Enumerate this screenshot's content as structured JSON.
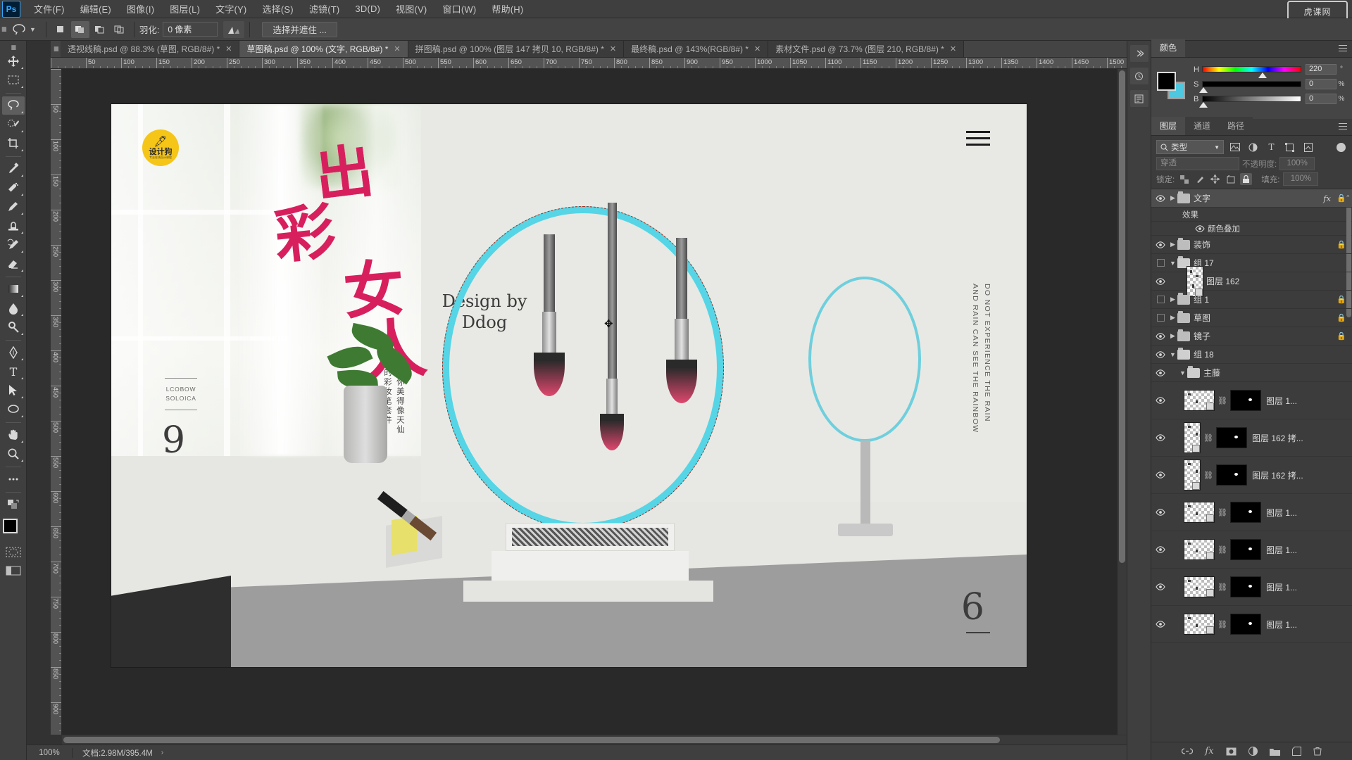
{
  "app": {
    "name": "Ps"
  },
  "menubar": {
    "items": [
      {
        "label": "文件(F)"
      },
      {
        "label": "编辑(E)"
      },
      {
        "label": "图像(I)"
      },
      {
        "label": "图层(L)"
      },
      {
        "label": "文字(Y)"
      },
      {
        "label": "选择(S)"
      },
      {
        "label": "滤镜(T)"
      },
      {
        "label": "3D(D)"
      },
      {
        "label": "视图(V)"
      },
      {
        "label": "窗口(W)"
      },
      {
        "label": "帮助(H)"
      }
    ],
    "watermark": "虎课网"
  },
  "optionsbar": {
    "tool": "lasso-tool",
    "feather_label": "羽化:",
    "feather_value": "0 像素",
    "antialias_name": "anti-alias-icon",
    "select_and_mask": "选择并遮住 ...",
    "selection_modes": [
      "new-selection",
      "add-to-selection",
      "subtract-from-selection",
      "intersect-selection"
    ],
    "active_mode_index": 1
  },
  "tabs": [
    {
      "label": "透视线稿.psd @ 88.3% (草图, RGB/8#) *",
      "active": false
    },
    {
      "label": "草图稿.psd @ 100% (文字, RGB/8#) *",
      "active": true
    },
    {
      "label": "拼图稿.psd @ 100% (图层 147 拷贝 10, RGB/8#) *",
      "active": false
    },
    {
      "label": "最终稿.psd @ 143%(RGB/8#) *",
      "active": false
    },
    {
      "label": "素材文件.psd @ 73.7% (图层 210, RGB/8#) *",
      "active": false
    }
  ],
  "toolbar": {
    "tools": [
      {
        "name": "move-tool",
        "glyph": "move"
      },
      {
        "name": "rectangular-marquee-tool",
        "glyph": "marquee"
      },
      {
        "name": "lasso-tool",
        "glyph": "lasso",
        "active": true
      },
      {
        "name": "quick-selection-tool",
        "glyph": "quickselect"
      },
      {
        "name": "crop-tool",
        "glyph": "crop"
      },
      {
        "name": "eyedropper-tool",
        "glyph": "eyedropper"
      },
      {
        "name": "spot-healing-brush-tool",
        "glyph": "heal"
      },
      {
        "name": "brush-tool",
        "glyph": "brush"
      },
      {
        "name": "clone-stamp-tool",
        "glyph": "stamp"
      },
      {
        "name": "history-brush-tool",
        "glyph": "historybrush"
      },
      {
        "name": "eraser-tool",
        "glyph": "eraser"
      },
      {
        "name": "gradient-tool",
        "glyph": "gradient"
      },
      {
        "name": "blur-tool",
        "glyph": "blur"
      },
      {
        "name": "dodge-tool",
        "glyph": "dodge"
      },
      {
        "name": "pen-tool",
        "glyph": "pen"
      },
      {
        "name": "horizontal-type-tool",
        "glyph": "type"
      },
      {
        "name": "path-selection-tool",
        "glyph": "pathselect"
      },
      {
        "name": "ellipse-tool",
        "glyph": "ellipse"
      },
      {
        "name": "hand-tool",
        "glyph": "hand"
      },
      {
        "name": "zoom-tool",
        "glyph": "zoom"
      },
      {
        "name": "edit-toolbar-tool",
        "glyph": "dots"
      }
    ],
    "foreground_color": "#000000",
    "background_color": "#4ec8e0",
    "quick_mask": "quick-mask-mode",
    "screen_mode": "screen-mode"
  },
  "rulers": {
    "unit_labels_h": [
      "50",
      "100",
      "150",
      "200",
      "250",
      "300",
      "350",
      "400",
      "450",
      "500",
      "550",
      "600",
      "650",
      "700",
      "750",
      "800",
      "850",
      "900",
      "950",
      "1000",
      "1050",
      "1100",
      "1150",
      "1200",
      "1250",
      "1300",
      "1350"
    ],
    "unit_labels_v": [
      "50",
      "100",
      "150",
      "200",
      "250",
      "300",
      "350",
      "400",
      "450",
      "500",
      "550",
      "600",
      "650",
      "700"
    ]
  },
  "canvas": {
    "poster": {
      "logo_icon": "设计狗",
      "logo_sub": "专业在线设计课程",
      "title_chars": [
        "出",
        "彩",
        "女",
        "人"
      ],
      "design_by": "Design by",
      "design_by_2": "Ddog",
      "vertical_tagline_a": "让你美得像天仙",
      "vertical_tagline_b": "的彩妆笔套件",
      "side_code_1": "LCOBOW",
      "side_code_2": "SOLOICA",
      "number_left": "9",
      "number_right": "6",
      "english_vertical": "DO NOT EXPERIENCE THE RAIN AND RAIN CAN SEE THE RAINBOW",
      "accent_ring_color": "#55d5e5",
      "title_color": "#d81f5e"
    }
  },
  "right_dock": {
    "color_panel": {
      "title": "颜色",
      "sliders": [
        {
          "label": "H",
          "value": "220",
          "unit": "°",
          "pos": 61
        },
        {
          "label": "S",
          "value": "0",
          "unit": "%",
          "pos": 1
        },
        {
          "label": "B",
          "value": "0",
          "unit": "%",
          "pos": 1
        }
      ]
    },
    "layers_panel": {
      "tabs": [
        {
          "label": "图层",
          "active": true
        },
        {
          "label": "通道",
          "active": false
        },
        {
          "label": "路径",
          "active": false
        }
      ],
      "filter_label": "类型",
      "filter_icons": [
        "pixel-filter-icon",
        "adjustment-filter-icon",
        "type-filter-icon",
        "shape-filter-icon",
        "smart-object-filter-icon"
      ],
      "blend_mode": "穿透",
      "opacity_label": "不透明度:",
      "opacity_value": "100%",
      "lock_label": "锁定:",
      "lock_icons": [
        "lock-transparent-icon",
        "lock-image-icon",
        "lock-position-icon",
        "lock-artboard-icon",
        "lock-all-icon"
      ],
      "fill_label": "填充:",
      "fill_value": "100%",
      "layers": [
        {
          "kind": "group",
          "name": "文字",
          "visible": true,
          "expanded": false,
          "locked": true,
          "has_fx": true,
          "active": true
        },
        {
          "kind": "effect-header",
          "name": "效果"
        },
        {
          "kind": "effect",
          "name": "颜色叠加",
          "visible": true
        },
        {
          "kind": "group",
          "name": "装饰",
          "visible": true,
          "expanded": false,
          "locked": true
        },
        {
          "kind": "group",
          "name": "组 17",
          "visible": false,
          "expanded": true,
          "locked": false
        },
        {
          "kind": "layer",
          "name": "图层 162",
          "visible": true,
          "thumb": "narrow",
          "smart": true
        },
        {
          "kind": "group",
          "name": "组 1",
          "visible": false,
          "expanded": false,
          "locked": true
        },
        {
          "kind": "group",
          "name": "草图",
          "visible": false,
          "expanded": false,
          "locked": true
        },
        {
          "kind": "group",
          "name": "镜子",
          "visible": true,
          "expanded": false,
          "locked": true
        },
        {
          "kind": "group",
          "name": "组 18",
          "visible": true,
          "expanded": true,
          "locked": false
        },
        {
          "kind": "group-sub",
          "name": "主藤",
          "visible": true,
          "expanded": true
        },
        {
          "kind": "masked",
          "name": "图层 1...",
          "visible": true,
          "thumb": "wide"
        },
        {
          "kind": "masked",
          "name": "图层 162 拷...",
          "visible": true,
          "thumb": "narrow"
        },
        {
          "kind": "masked",
          "name": "图层 162 拷...",
          "visible": true,
          "thumb": "narrow"
        },
        {
          "kind": "masked",
          "name": "图层 1...",
          "visible": true,
          "thumb": "wide"
        },
        {
          "kind": "masked",
          "name": "图层 1...",
          "visible": true,
          "thumb": "wide"
        },
        {
          "kind": "masked",
          "name": "图层 1...",
          "visible": true,
          "thumb": "wide"
        },
        {
          "kind": "masked",
          "name": "图层 1...",
          "visible": true,
          "thumb": "wide"
        }
      ],
      "footer_icons": [
        "link-layers-icon",
        "add-layer-style-icon",
        "add-layer-mask-icon",
        "new-adjustment-layer-icon",
        "new-group-icon",
        "new-layer-icon",
        "delete-layer-icon"
      ]
    }
  },
  "statusbar": {
    "zoom": "100%",
    "doc_info": "文档:2.98M/395.4M",
    "expand_arrow": "›"
  }
}
